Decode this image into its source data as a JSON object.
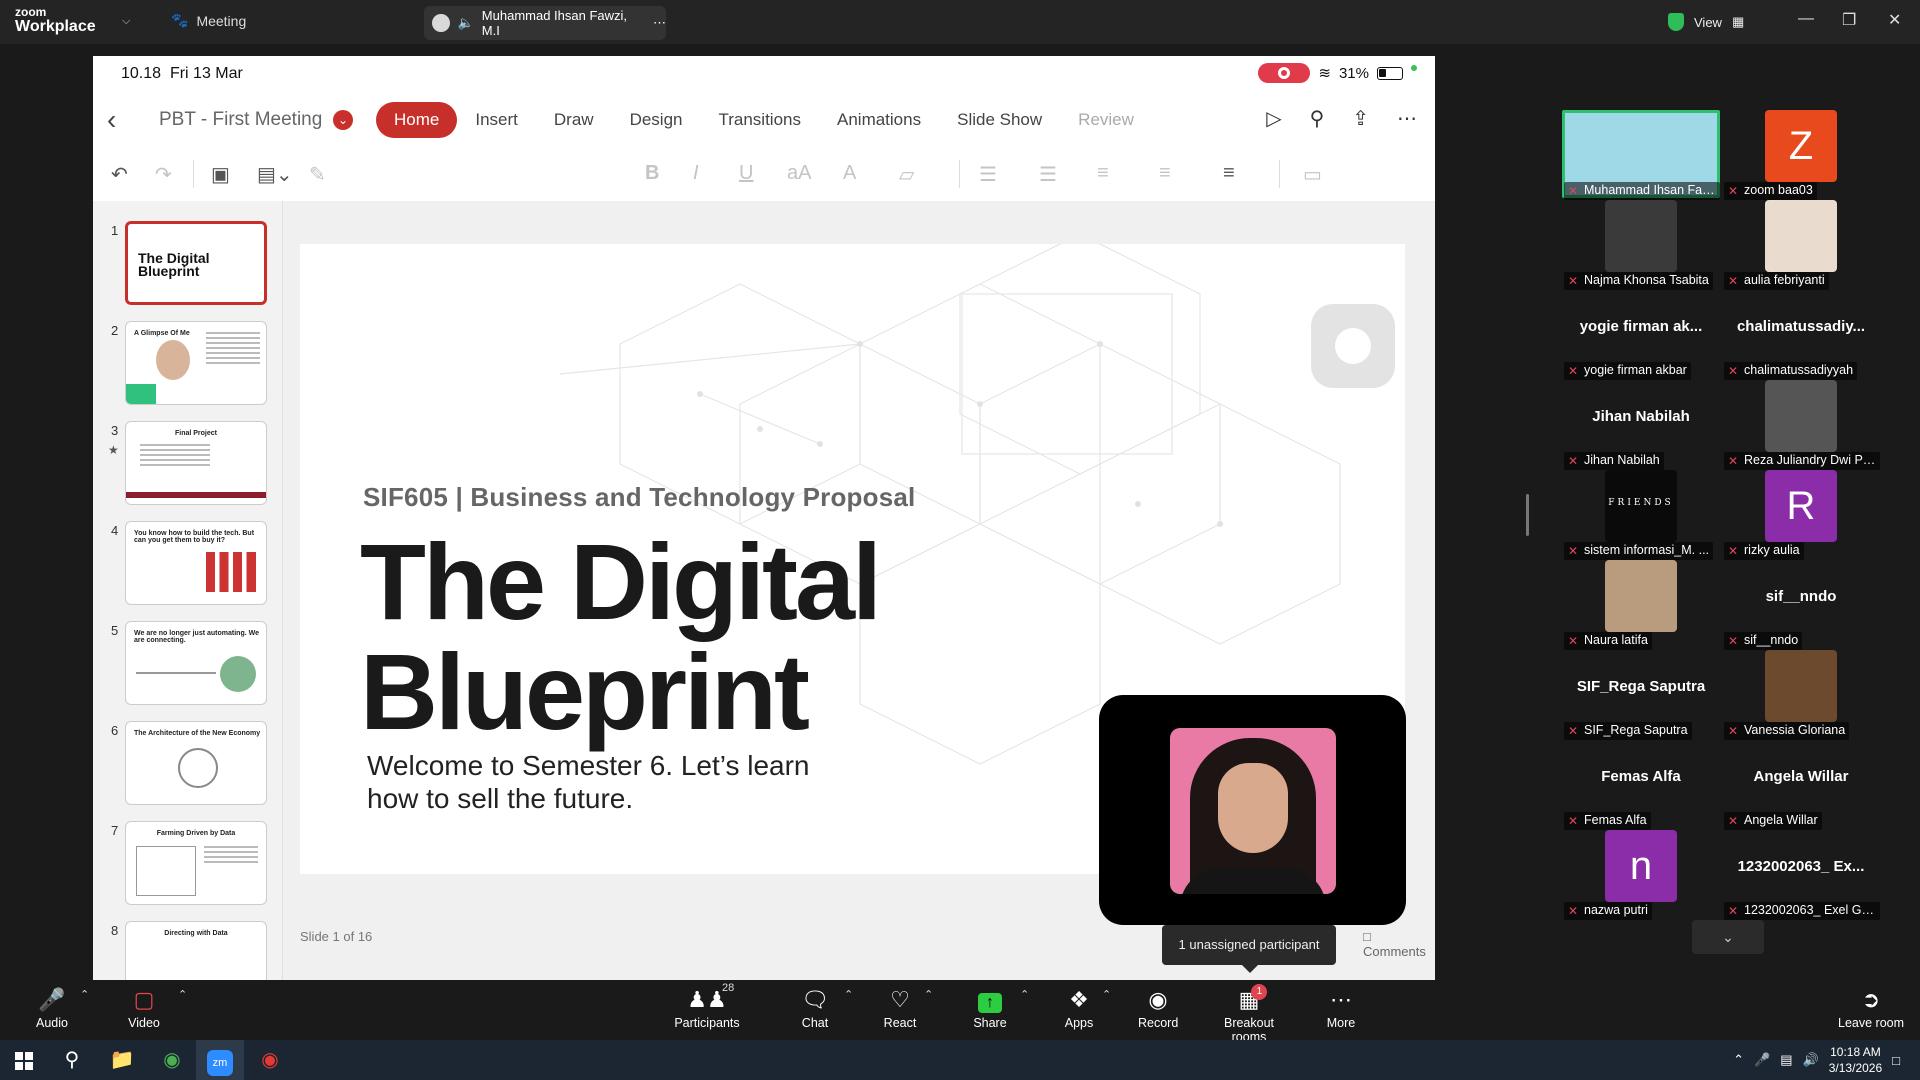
{
  "titlebar": {
    "logo_top": "zoom",
    "logo_bottom": "Workplace",
    "meeting_label": "Meeting",
    "tab_label": "Muhammad Ihsan Fawzi, M.I",
    "view_label": "View"
  },
  "ipad": {
    "time": "10.18",
    "date": "Fri 13 Mar",
    "battery": "31%"
  },
  "ppt": {
    "doc_title": "PBT - First Meeting",
    "tabs": [
      "Home",
      "Insert",
      "Draw",
      "Design",
      "Transitions",
      "Animations",
      "Slide Show",
      "Review"
    ],
    "active_tab": "Home",
    "slide_counter": "Slide 1 of 16",
    "comments_label": "Comments"
  },
  "thumbnails": [
    {
      "num": "1",
      "title": "The Digital Blueprint"
    },
    {
      "num": "2",
      "title": "A Glimpse Of Me"
    },
    {
      "num": "3",
      "title": "Final Project"
    },
    {
      "num": "4",
      "title": "You know how to build the tech. But can you get them to buy it?"
    },
    {
      "num": "5",
      "title": "We are no longer just automating. We are connecting."
    },
    {
      "num": "6",
      "title": "The Architecture of the New Economy"
    },
    {
      "num": "7",
      "title": "Farming Driven by Data"
    },
    {
      "num": "8",
      "title": "Directing with Data"
    }
  ],
  "slide": {
    "course": "SIF605 | Business and Technology Proposal",
    "title_line1": "The Digital",
    "title_line2": "Blueprint",
    "subtitle_line1": "Welcome to Semester 6. Let’s learn",
    "subtitle_line2": "how to sell the future."
  },
  "tooltip": "1 unassigned participant",
  "participants": [
    {
      "name": "Muhammad Ihsan Fawzi,...",
      "type": "video",
      "color": "#9fd8e6"
    },
    {
      "name": "zoom baa03",
      "type": "letter",
      "letter": "Z",
      "color": "#e8491d"
    },
    {
      "name": "Najma Khonsa Tsabita",
      "type": "photo",
      "color": "#3a3a3a"
    },
    {
      "name": "aulia febriyanti",
      "type": "photo",
      "color": "#e9dccf"
    },
    {
      "name": "yogie firman akbar",
      "big": "yogie firman ak...",
      "type": "text"
    },
    {
      "name": "chalimatussadiyyah",
      "big": "chalimatussadiy...",
      "type": "text"
    },
    {
      "name": "Jihan Nabilah",
      "big": "Jihan Nabilah",
      "type": "text"
    },
    {
      "name": "Reza Juliandry Dwi Pu...",
      "type": "photo",
      "color": "#555"
    },
    {
      "name": "sistem informasi_M. ...",
      "type": "photo",
      "color": "#0a0a0a",
      "label": "FRIENDS"
    },
    {
      "name": "rizky aulia",
      "type": "letter",
      "letter": "R",
      "color": "#8b2ca8"
    },
    {
      "name": "Naura latifa",
      "type": "photo",
      "color": "#b99b7d"
    },
    {
      "name": "sif__nndo",
      "big": "sif__nndo",
      "type": "text"
    },
    {
      "name": "SIF_Rega Saputra",
      "big": "SIF_Rega Saputra",
      "type": "text"
    },
    {
      "name": "Vanessia Gloriana",
      "type": "photo",
      "color": "#6b4a2e"
    },
    {
      "name": "Femas Alfa",
      "big": "Femas Alfa",
      "type": "text"
    },
    {
      "name": "Angela Willar",
      "big": "Angela Willar",
      "type": "text"
    },
    {
      "name": "nazwa putri",
      "type": "letter",
      "letter": "n",
      "color": "#8b2ca8"
    },
    {
      "name": "1232002063_ Exel Go...",
      "big": "1232002063_ Ex...",
      "type": "text"
    }
  ],
  "meetbar": {
    "audio": "Audio",
    "video": "Video",
    "participants": "Participants",
    "participants_count": "28",
    "chat": "Chat",
    "react": "React",
    "share": "Share",
    "apps": "Apps",
    "record": "Record",
    "breakout": "Breakout rooms",
    "breakout_badge": "1",
    "more": "More",
    "leave": "Leave room"
  },
  "taskbar": {
    "time": "10:18 AM",
    "date": "3/13/2026"
  },
  "colors": {
    "accent_red": "#c7302a",
    "speaker_green": "#2fbf71",
    "share_green": "#2ecc40"
  }
}
